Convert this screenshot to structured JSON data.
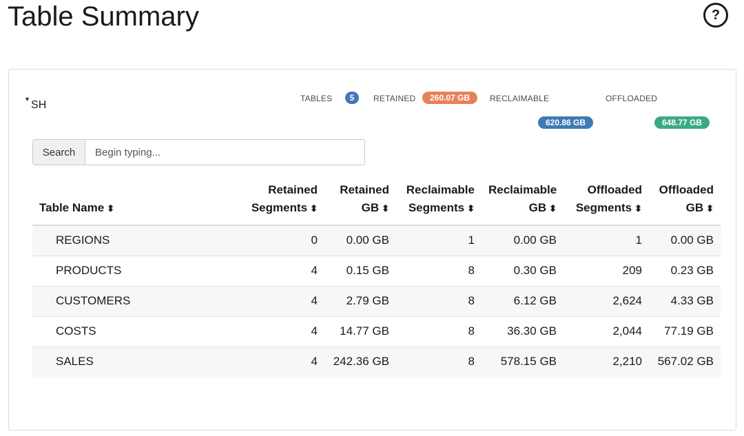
{
  "page": {
    "title": "Table Summary",
    "help_symbol": "?"
  },
  "schema": {
    "name": "SH",
    "caret": "▾",
    "stats": {
      "tables_label": "TABLES",
      "tables_count": "5",
      "retained_label": "RETAINED",
      "retained_value": "260.07 GB",
      "reclaimable_label": "RECLAIMABLE",
      "reclaimable_value": "620.86 GB",
      "offloaded_label": "OFFLOADED",
      "offloaded_value": "648.77 GB"
    }
  },
  "colors": {
    "tables_badge": "#3f7ab5",
    "retained_badge": "#e6825a",
    "reclaimable_badge": "#3f7ab5",
    "offloaded_badge": "#3aaa85"
  },
  "search": {
    "addon_label": "Search",
    "placeholder": "Begin typing..."
  },
  "table": {
    "headers": [
      {
        "line1": "",
        "line2": "Table Name"
      },
      {
        "line1": "Retained",
        "line2": "Segments"
      },
      {
        "line1": "Retained",
        "line2": "GB"
      },
      {
        "line1": "Reclaimable",
        "line2": "Segments"
      },
      {
        "line1": "Reclaimable",
        "line2": "GB"
      },
      {
        "line1": "Offloaded",
        "line2": "Segments"
      },
      {
        "line1": "Offloaded",
        "line2": "GB"
      }
    ],
    "sort_icon": "⬍",
    "rows": [
      [
        "REGIONS",
        "0",
        "0.00 GB",
        "1",
        "0.00 GB",
        "1",
        "0.00 GB"
      ],
      [
        "PRODUCTS",
        "4",
        "0.15 GB",
        "8",
        "0.30 GB",
        "209",
        "0.23 GB"
      ],
      [
        "CUSTOMERS",
        "4",
        "2.79 GB",
        "8",
        "6.12 GB",
        "2,624",
        "4.33 GB"
      ],
      [
        "COSTS",
        "4",
        "14.77 GB",
        "8",
        "36.30 GB",
        "2,044",
        "77.19 GB"
      ],
      [
        "SALES",
        "4",
        "242.36 GB",
        "8",
        "578.15 GB",
        "2,210",
        "567.02 GB"
      ]
    ]
  }
}
